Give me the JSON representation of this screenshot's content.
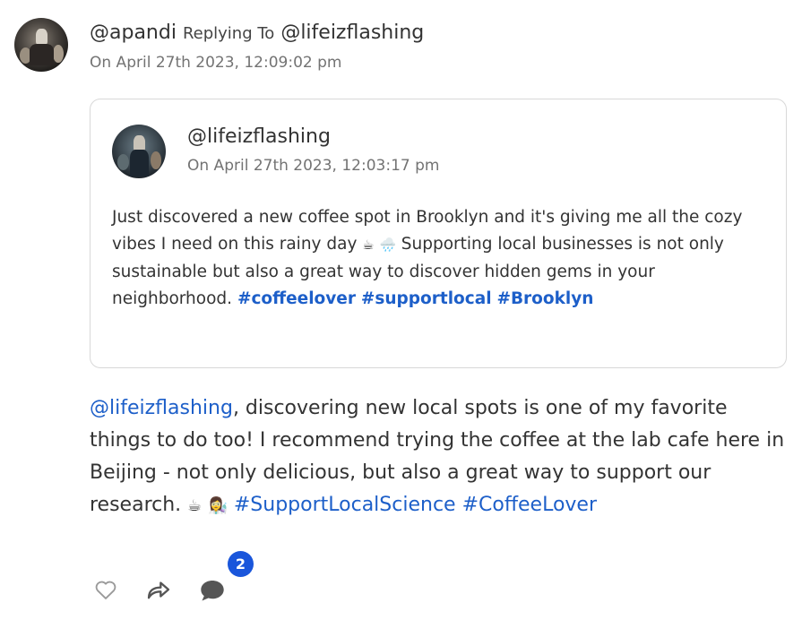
{
  "reply": {
    "author": "@apandi",
    "replying_to_label": "Replying To",
    "replying_to_handle": "@lifeizflashing",
    "timestamp": "On April 27th 2023, 12:09:02 pm",
    "mention": "@lifeizflashing",
    "text": ", discovering new local spots is one of my favorite things to do too! I recommend trying the coffee at the lab cafe here in Beijing - not only delicious, but also a great way to support our research. ",
    "emoji_1": "☕",
    "emoji_2": "👩‍🔬",
    "hashtags": [
      "#SupportLocalScience",
      "#CoffeeLover"
    ]
  },
  "quoted": {
    "author": "@lifeizflashing",
    "timestamp": "On April 27th 2023, 12:03:17 pm",
    "text": "Just discovered a new coffee spot in Brooklyn and it's giving me all the cozy vibes I need on this rainy day ",
    "emoji_1": "☕",
    "emoji_2": "🌧️",
    "text_2": " Supporting local businesses is not only sustainable but also a great way to discover hidden gems in your neighborhood. ",
    "hashtags": [
      "#coffeelover",
      "#supportlocal",
      "#Brooklyn"
    ]
  },
  "actions": {
    "like_icon": "heart-icon",
    "share_icon": "share-icon",
    "comment_icon": "comment-icon",
    "comment_count": "2"
  },
  "colors": {
    "link": "#1d5fc9",
    "badge": "#1a56db",
    "muted": "#737373"
  }
}
